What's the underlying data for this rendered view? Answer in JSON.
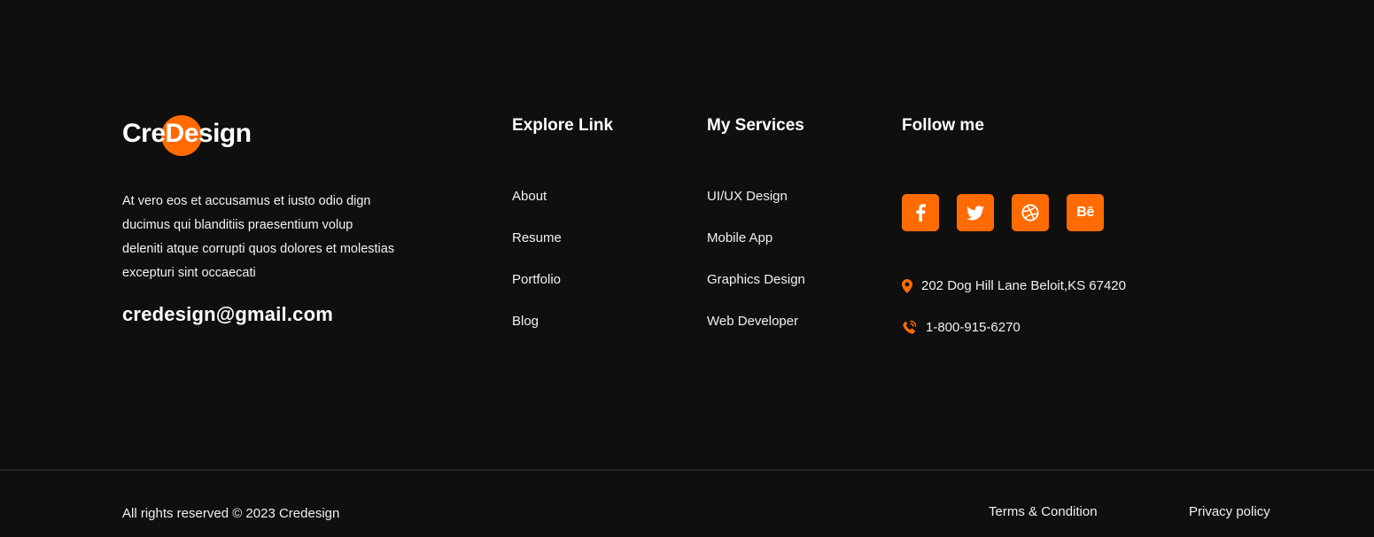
{
  "brand": {
    "logo_part1": "Cre",
    "logo_part2": "Design",
    "description": "At vero eos et accusamus et iusto odio dign ducimus qui blanditiis praesentium volup deleniti atque corrupti quos dolores et molestias excepturi sint occaecati",
    "email": "credesign@gmail.com"
  },
  "explore": {
    "title": "Explore Link",
    "items": [
      "About",
      "Resume",
      "Portfolio",
      "Blog"
    ]
  },
  "services": {
    "title": "My Services",
    "items": [
      "UI/UX Design",
      "Mobile App",
      "Graphics Design",
      "Web Developer"
    ]
  },
  "follow": {
    "title": "Follow me",
    "socials": [
      {
        "icon": "facebook-icon"
      },
      {
        "icon": "twitter-icon"
      },
      {
        "icon": "dribbble-icon"
      },
      {
        "icon": "behance-icon",
        "label": "Bē"
      }
    ],
    "address": "202 Dog Hill Lane Beloit,KS 67420",
    "phone": "1-800-915-6270"
  },
  "bottom": {
    "copyright": "All rights reserved © 2023 Credesign",
    "terms": "Terms & Condition",
    "privacy": "Privacy policy"
  },
  "colors": {
    "background": "#0f0f0f",
    "accent": "#ff6b00",
    "text": "#ffffff"
  }
}
